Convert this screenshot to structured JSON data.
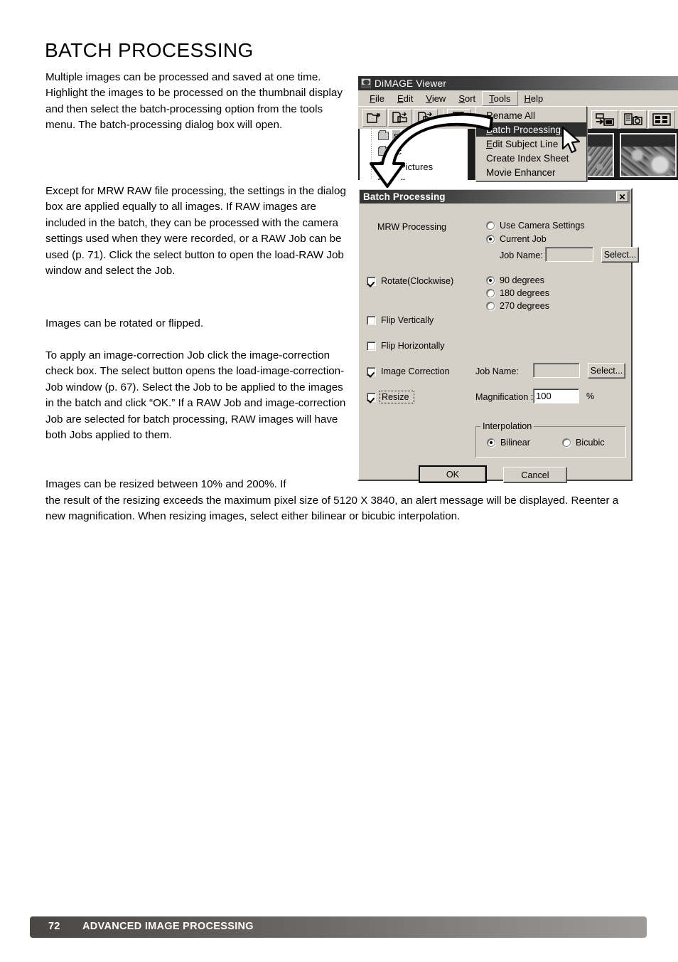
{
  "page": {
    "title": "BATCH PROCESSING",
    "footer": {
      "page_number": "72",
      "section_title": "ADVANCED IMAGE PROCESSING"
    },
    "paragraphs": {
      "p1": "Multiple images can be processed and saved at one time. Highlight the images to be processed on the thumbnail display and then select the batch-processing option from the tools menu. The batch-processing dialog box will open.",
      "p2": "Except for MRW RAW file processing, the settings in the dialog box are applied equally to all images. If RAW images are included in the batch, they can be processed with the camera settings used when they were recorded, or a RAW Job can be used (p. 71). Click the select button to open the load-RAW Job window and select the Job.",
      "p3": "Images can be rotated or flipped.",
      "p4": "To apply an image-correction Job click the image-correction check box. The select button opens the load-image-correction-Job window (p. 67). Select the Job to be applied to the images in the batch and click “OK.” If a RAW Job and image-correction Job are selected for batch processing, RAW images will have both Jobs applied to them.",
      "p5a": "Images can be resized between 10% and 200%. If",
      "p5b": "the result of the resizing exceeds the maximum pixel size of 5120 X 3840, an alert message will be displayed. Reenter a new magnification. When resizing images, select either bilinear or bicubic interpolation."
    }
  },
  "viewer_window": {
    "title": "DiMAGE Viewer",
    "menubar": [
      {
        "label": "File",
        "mnemonic": "F",
        "rest": "ile"
      },
      {
        "label": "Edit",
        "mnemonic": "E",
        "rest": "dit"
      },
      {
        "label": "View",
        "mnemonic": "V",
        "rest": "iew"
      },
      {
        "label": "Sort",
        "mnemonic": "S",
        "rest": "ort"
      },
      {
        "label": "Tools",
        "mnemonic": "T",
        "rest": "ools"
      },
      {
        "label": "Help",
        "mnemonic": "H",
        "rest": "elp"
      }
    ],
    "toolbar_icons": [
      "open-folder-icon",
      "copy-to-folder-icon",
      "move-to-folder-icon",
      "save-icon",
      "transfer-image-icon",
      "camera-info-icon",
      "thumbnail-grid-icon"
    ],
    "tree_items": [
      {
        "label": "Images",
        "partial": "s",
        "selected": true
      },
      {
        "label": "Misc",
        "partial": "sc",
        "selected": false
      },
      {
        "label": "My Pictures",
        "partial": "y Pictures",
        "selected": false
      },
      {
        "label": "Stuff",
        "partial": "tuff",
        "selected": false
      }
    ]
  },
  "tools_menu": {
    "items": [
      {
        "label": "Rename All",
        "mnemonic": "R",
        "rest": "ename All",
        "highlighted": false
      },
      {
        "label": "Batch Processing",
        "mnemonic": "B",
        "rest": "atch Processing",
        "highlighted": true
      },
      {
        "label": "Edit Subject Line",
        "mnemonic": "E",
        "rest": "dit Subject Line",
        "highlighted": false
      },
      {
        "label": "Create Index Sheet",
        "mnemonic": "C",
        "rest": "reate Index Sheet",
        "highlighted": false
      },
      {
        "label": "Movie Enhancer",
        "mnemonic": "M",
        "rest": "ovie Enhancer",
        "highlighted": false
      }
    ]
  },
  "batch_dialog": {
    "title": "Batch Processing",
    "close_label": "✕",
    "mrw_processing_label": "MRW Processing",
    "mrw_options": [
      {
        "label": "Use Camera Settings",
        "selected": false
      },
      {
        "label": "Current Job",
        "selected": true
      }
    ],
    "raw_job_name_label": "Job Name:",
    "raw_job_name_value": "",
    "raw_select_label": "Select...",
    "rotate_label": "Rotate(Clockwise)",
    "rotate_checked": true,
    "rotate_options": [
      {
        "label": "90 degrees",
        "selected": true
      },
      {
        "label": "180 degrees",
        "selected": false
      },
      {
        "label": "270 degrees",
        "selected": false
      }
    ],
    "flip_vertically_label": "Flip Vertically",
    "flip_vertically_checked": false,
    "flip_horizontally_label": "Flip Horizontally",
    "flip_horizontally_checked": false,
    "image_correction_label": "Image Correction",
    "image_correction_checked": true,
    "correction_job_name_label": "Job Name:",
    "correction_job_name_value": "",
    "correction_select_label": "Select...",
    "resize_label": "Resize",
    "resize_checked": true,
    "magnification_label": "Magnification :",
    "magnification_value": "100",
    "magnification_unit": "%",
    "interpolation_label": "Interpolation",
    "interpolation_options": [
      {
        "label": "Bilinear",
        "selected": true
      },
      {
        "label": "Bicubic",
        "selected": false
      }
    ],
    "ok_label": "OK",
    "cancel_label": "Cancel"
  },
  "colors": {
    "dialog_face": "#d4d0c8",
    "titlebar_dark": "#2b2b2b",
    "highlight": "#2d2d2d",
    "footer_dark": "#4a4745",
    "footer_light": "#9d9a98"
  }
}
